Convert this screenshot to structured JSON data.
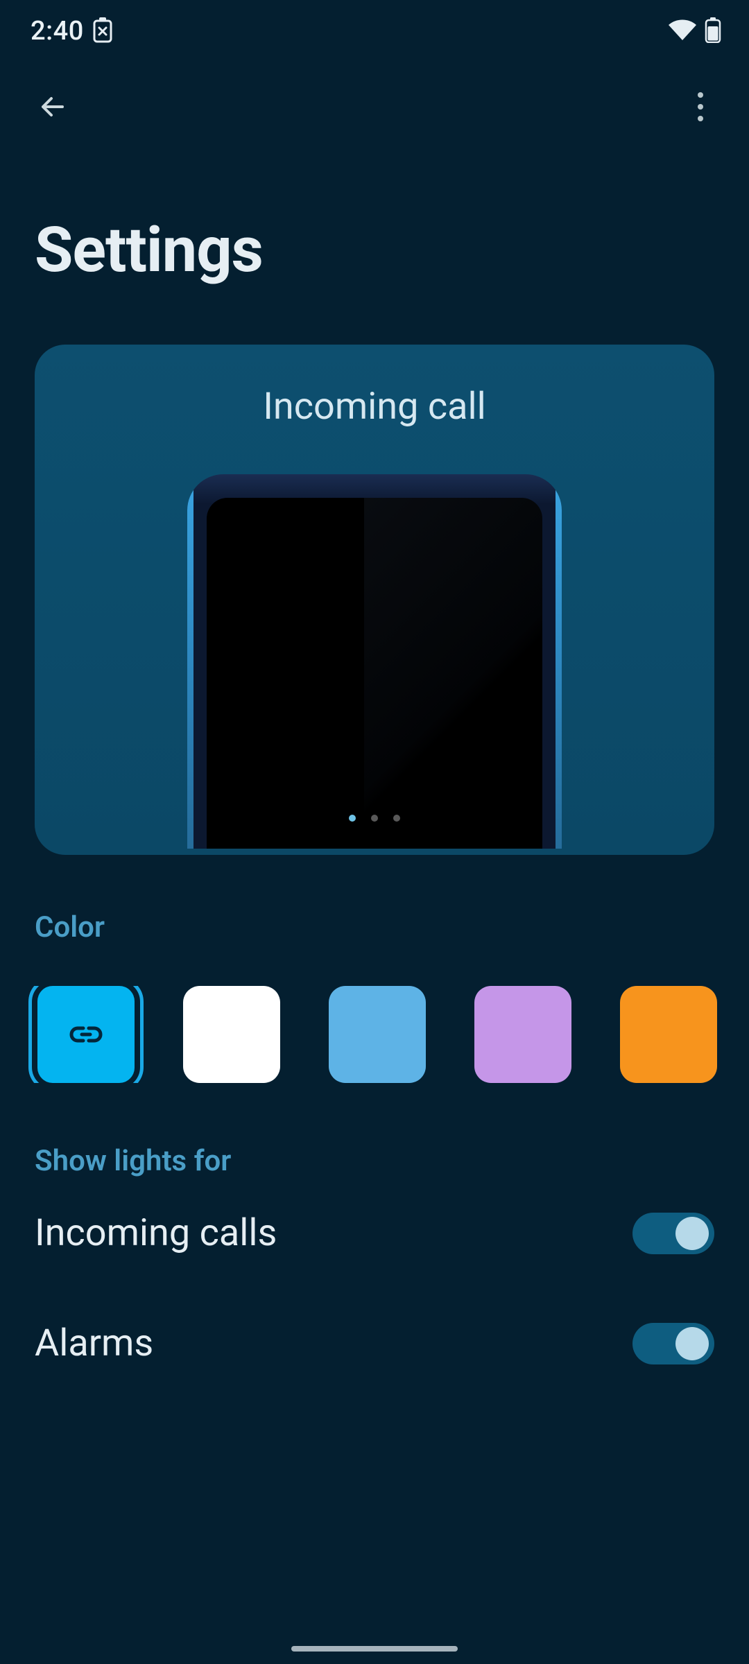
{
  "status_bar": {
    "time": "2:40"
  },
  "page": {
    "title": "Settings"
  },
  "preview": {
    "title": "Incoming call",
    "dots_total": 3,
    "active_dot": 0
  },
  "sections": {
    "color": {
      "label": "Color",
      "swatches": [
        {
          "name": "link-accent",
          "color": "#04b4f0",
          "selected": true,
          "has_link_icon": true
        },
        {
          "name": "white",
          "color": "#ffffff",
          "selected": false
        },
        {
          "name": "sky-blue",
          "color": "#5eb3e6",
          "selected": false
        },
        {
          "name": "lavender",
          "color": "#c596e8",
          "selected": false
        },
        {
          "name": "orange",
          "color": "#f7941d",
          "selected": false
        }
      ]
    },
    "show_lights": {
      "label": "Show lights for",
      "items": [
        {
          "label": "Incoming calls",
          "enabled": true
        },
        {
          "label": "Alarms",
          "enabled": true
        }
      ]
    }
  },
  "colors": {
    "bg": "#041f30",
    "card": "#0d4f6f",
    "accent": "#4a9ec7",
    "toggle_track": "#0e5d80",
    "toggle_thumb": "#b6d9e9"
  }
}
